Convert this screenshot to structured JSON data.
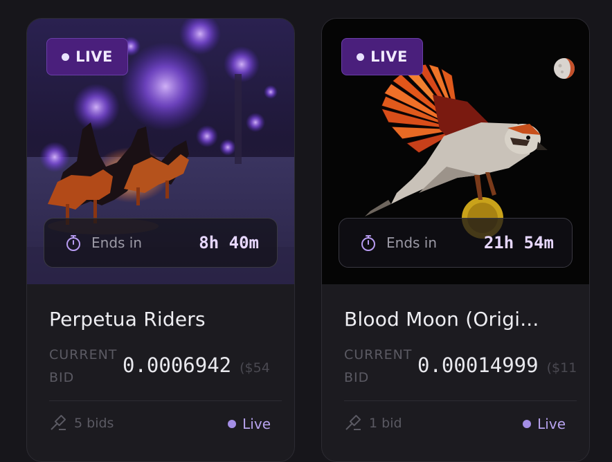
{
  "cards": [
    {
      "badge": "LIVE",
      "timer_label": "Ends in",
      "timer_value": "8h 40m",
      "title": "Perpetua Riders",
      "bid_label": "CURRENT BID",
      "bid_value": "0.0006942",
      "bid_usd": "($54",
      "bids": "5 bids",
      "status": "Live"
    },
    {
      "badge": "LIVE",
      "timer_label": "Ends in",
      "timer_value": "21h 54m",
      "title": "Blood Moon (Origi...",
      "bid_label": "CURRENT BID",
      "bid_value": "0.00014999",
      "bid_usd": "($11",
      "bids": "1 bid",
      "status": "Live"
    }
  ],
  "colors": {
    "page_bg": "#17161b",
    "card_bg": "#1c1b20",
    "badge_bg": "#4a1f7c",
    "accent": "#a48ee6",
    "timer_value": "#e7d7ff"
  },
  "icons": [
    "stopwatch-icon",
    "gavel-icon",
    "moon-icon",
    "live-dot"
  ]
}
